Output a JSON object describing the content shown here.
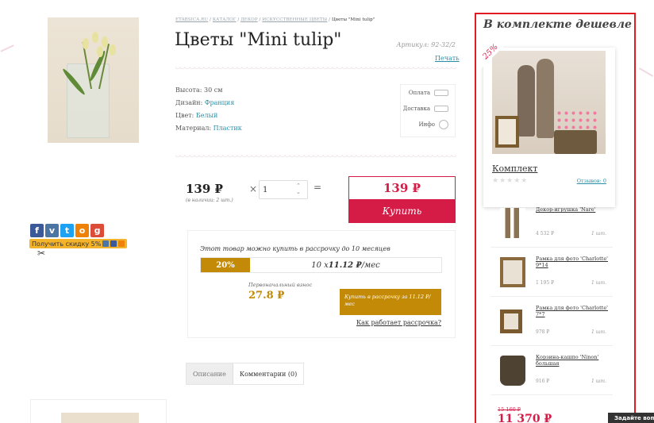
{
  "breadcrumb": {
    "home": "ETABSICA.RU",
    "catalog": "КАТАЛОГ",
    "decor": "ДЕКОР",
    "artificial": "ИСКУССТВЕННЫЕ ЦВЕТЫ",
    "current": "Цветы \"Mini tulip\"",
    "sep": "/"
  },
  "product": {
    "title": "Цветы \"Mini tulip\"",
    "sku": "Артикул: 92-32/2",
    "print": "Печать",
    "specs": [
      {
        "label": "Высота: ",
        "value": "30 см"
      },
      {
        "label": "Дизайн: ",
        "value": "Франция"
      },
      {
        "label": "Цвет: ",
        "value": "Белый"
      },
      {
        "label": "Материал: ",
        "value": "Пластик"
      }
    ]
  },
  "infobox": {
    "pay": "Оплата",
    "delivery": "Доставка",
    "info": "Инфо"
  },
  "order": {
    "price": "139 ₽",
    "stock": "(в наличии: 2 шт.)",
    "times": "×",
    "qty": "1",
    "eq": "=",
    "total": "139 ₽",
    "buy": "Купить"
  },
  "installment": {
    "title": "Этот товар можно купить в рассрочку до 10 месяцев",
    "percent": "20%",
    "monthly_prefix": "10 x ",
    "monthly_amount": "11.12 ₽",
    "monthly_suffix": "/мес",
    "down_label": "Первоначальный взнос",
    "down_value": "27.8 ₽",
    "button": "Купить в рассрочку за 11.12 ₽/мес",
    "how": "Как работает рассрочка?"
  },
  "tabs": {
    "desc": "Описание",
    "comments": "Комментарии (0)"
  },
  "social": {
    "discount": "Получить скидку 5%"
  },
  "bundle": {
    "heading": "В комплекте дешевле",
    "badge": "25%",
    "name": "Комплект",
    "stars": "★★★★★",
    "reviews": "Отзывов: 0",
    "items": [
      {
        "name": "Декор-игрушка 'Nare'",
        "price": "4 532 ₽",
        "count": "1 шт."
      },
      {
        "name": "Рамка для фото 'Charlotte' 9*14",
        "price": "1 195 ₽",
        "count": "1 шт."
      },
      {
        "name": "Рамка для фото 'Charlotte' 7*7",
        "price": "978 ₽",
        "count": "1 шт."
      },
      {
        "name": "Корзина-кашпо 'Ninon' большая",
        "price": "916 ₽",
        "count": "1 шт."
      }
    ],
    "old_price": "15 160 ₽",
    "new_price": "11 370 ₽"
  },
  "ask": "Задайте вопрос",
  "colors": {
    "accent": "#d41c47",
    "gold": "#c38a07",
    "panel_border": "#e01b24",
    "link": "#2a8fa6"
  }
}
